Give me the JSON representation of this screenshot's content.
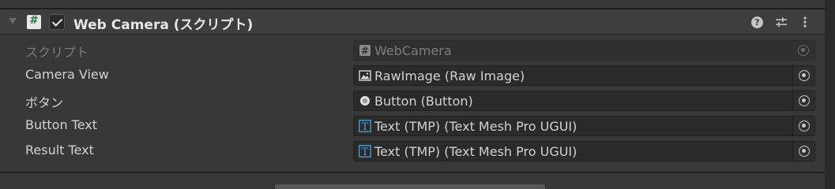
{
  "component": {
    "title": "Web Camera (スクリプト)",
    "enabled": true
  },
  "fields": [
    {
      "label": "スクリプト",
      "value": "WebCamera",
      "icon": "script-icon",
      "disabled": true
    },
    {
      "label": "Camera View",
      "value": "RawImage (Raw Image)",
      "icon": "image-icon",
      "disabled": false
    },
    {
      "label": "ボタン",
      "value": "Button (Button)",
      "icon": "radio-icon",
      "disabled": false
    },
    {
      "label": "Button Text",
      "value": "Text (TMP) (Text Mesh Pro UGUI)",
      "icon": "text-icon",
      "disabled": false
    },
    {
      "label": "Result Text",
      "value": "Text (TMP) (Text Mesh Pro UGUI)",
      "icon": "text-icon",
      "disabled": false
    }
  ],
  "colors": {
    "background": "#383838",
    "header": "#3e3e3e",
    "field": "#2a2a2a",
    "text_icon_blue": "#4aa3df",
    "script_icon_green": "#2f7d46"
  }
}
